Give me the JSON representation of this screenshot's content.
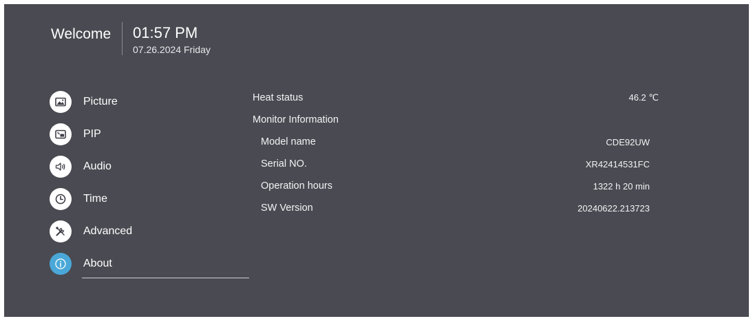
{
  "header": {
    "welcome": "Welcome",
    "time": "01:57 PM",
    "date": "07.26.2024 Friday"
  },
  "menu": {
    "items": [
      {
        "label": "Picture",
        "icon": "picture-icon"
      },
      {
        "label": "PIP",
        "icon": "pip-icon"
      },
      {
        "label": "Audio",
        "icon": "speaker-icon"
      },
      {
        "label": "Time",
        "icon": "clock-icon"
      },
      {
        "label": "Advanced",
        "icon": "tools-icon"
      },
      {
        "label": "About",
        "icon": "info-icon",
        "active": true
      }
    ]
  },
  "about": {
    "heat_label": "Heat status",
    "heat_value": "46.2 ℃",
    "monitor_info_label": "Monitor Information",
    "model_label": "Model name",
    "model_value": "CDE92UW",
    "serial_label": "Serial NO.",
    "serial_value": "XR42414531FC",
    "hours_label": "Operation hours",
    "hours_value": "1322 h 20 min",
    "sw_label": "SW Version",
    "sw_value": "20240622.213723"
  },
  "colors": {
    "background": "#4a4a52",
    "accent": "#4aa8d8",
    "text": "#ffffff"
  }
}
